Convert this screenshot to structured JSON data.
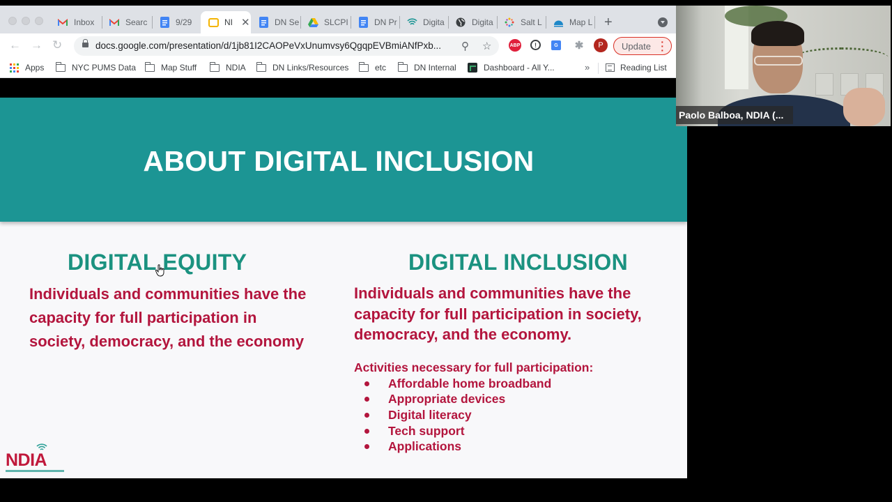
{
  "browser": {
    "tabs": [
      {
        "label": "Inbox",
        "icon": "gmail-icon",
        "active": false
      },
      {
        "label": "Searc",
        "icon": "gmail-icon",
        "active": false
      },
      {
        "label": "9/29",
        "icon": "google-docs-icon",
        "active": false
      },
      {
        "label": "NI",
        "icon": "google-slides-icon",
        "active": true
      },
      {
        "label": "DN Se",
        "icon": "google-docs-icon",
        "active": false
      },
      {
        "label": "SLCPI",
        "icon": "google-drive-icon",
        "active": false
      },
      {
        "label": "DN Pr",
        "icon": "google-docs-icon",
        "active": false
      },
      {
        "label": "Digita",
        "icon": "wifi-icon",
        "active": false
      },
      {
        "label": "Digita",
        "icon": "globe-icon",
        "active": false
      },
      {
        "label": "Salt L",
        "icon": "dots-icon",
        "active": false
      },
      {
        "label": "Map L",
        "icon": "altru-icon",
        "active": false
      }
    ],
    "close_tab_glyph": "✕",
    "new_tab_glyph": "+",
    "address": "docs.google.com/presentation/d/1jb81I2CAOPeVxUnumvsy6QgqpEVBmiANfPxb...",
    "profile_initial": "P",
    "update_label": "Update",
    "extensions": [
      "ABP",
      "1Password",
      "Google Translate",
      "Extensions"
    ],
    "bookmarks": [
      {
        "label": "Apps",
        "icon": "apps-grid-icon"
      },
      {
        "label": "NYC PUMS Data",
        "icon": "folder-icon"
      },
      {
        "label": "Map Stuff",
        "icon": "folder-icon"
      },
      {
        "label": "NDIA",
        "icon": "folder-icon"
      },
      {
        "label": "DN Links/Resources",
        "icon": "folder-icon"
      },
      {
        "label": "etc",
        "icon": "folder-icon"
      },
      {
        "label": "DN Internal",
        "icon": "folder-icon"
      },
      {
        "label": "Dashboard - All Y...",
        "icon": "dashboard-icon"
      }
    ],
    "bookmarks_overflow": "»",
    "reading_list": "Reading List"
  },
  "slide": {
    "title": "ABOUT DIGITAL INCLUSION",
    "equity": {
      "heading": "DIGITAL EQUITY",
      "body": "Individuals and communities have the capacity for full participation in society, democracy, and the economy"
    },
    "inclusion": {
      "heading": "DIGITAL INCLUSION",
      "body": "Individuals and communities have the capacity for full participation in society, democracy, and the economy.",
      "activities_heading": "Activities necessary for full participation:",
      "activities": [
        "Affordable home broadband",
        "Appropriate devices",
        "Digital literacy",
        "Tech support",
        "Applications"
      ]
    },
    "logo_text": "NDIA",
    "colors": {
      "header_bg": "#1c9594",
      "heading_teal": "#1b9280",
      "body_red": "#b3153d"
    }
  },
  "video": {
    "participant_name": "Paolo Balboa, NDIA (..."
  }
}
